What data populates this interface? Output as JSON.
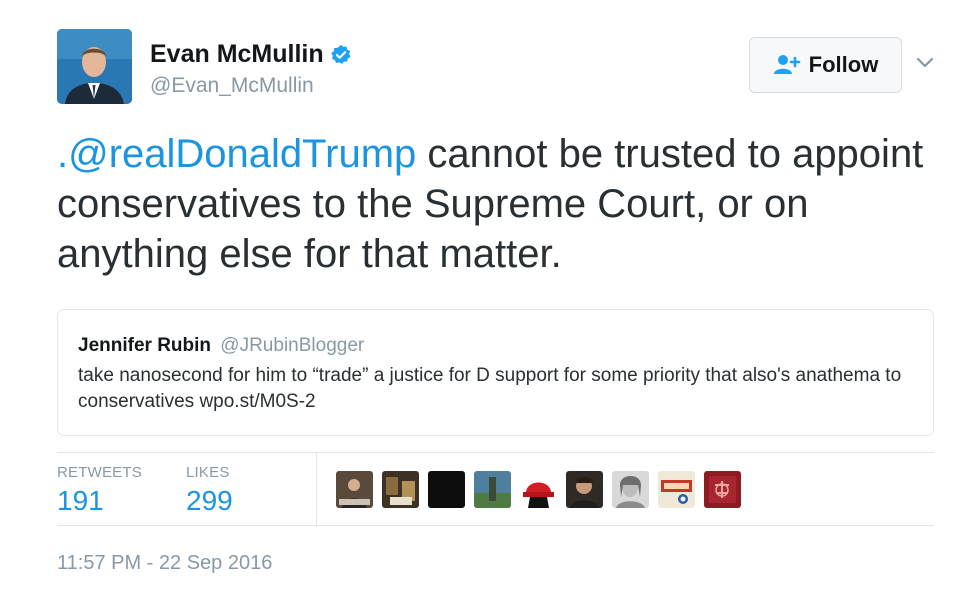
{
  "author": {
    "name": "Evan McMullin",
    "handle": "@Evan_McMullin"
  },
  "follow": {
    "label": "Follow"
  },
  "tweet": {
    "mention": ".@realDonaldTrump",
    "text": " cannot be trusted to appoint conservatives to the Supreme Court, or on anything else for that matter."
  },
  "quoted": {
    "name": "Jennifer Rubin",
    "handle": "@JRubinBlogger",
    "text": "take nanosecond for him to “trade” a justice for D support for some priority that also's anathema to conservatives wpo.st/M0S-2"
  },
  "stats": {
    "retweets_label": "RETWEETS",
    "retweets": "191",
    "likes_label": "LIKES",
    "likes": "299"
  },
  "timestamp": "11:57 PM - 22 Sep 2016",
  "colors": {
    "link": "#1b95e0",
    "muted": "#8899a6",
    "verified": "#1da1f2"
  }
}
